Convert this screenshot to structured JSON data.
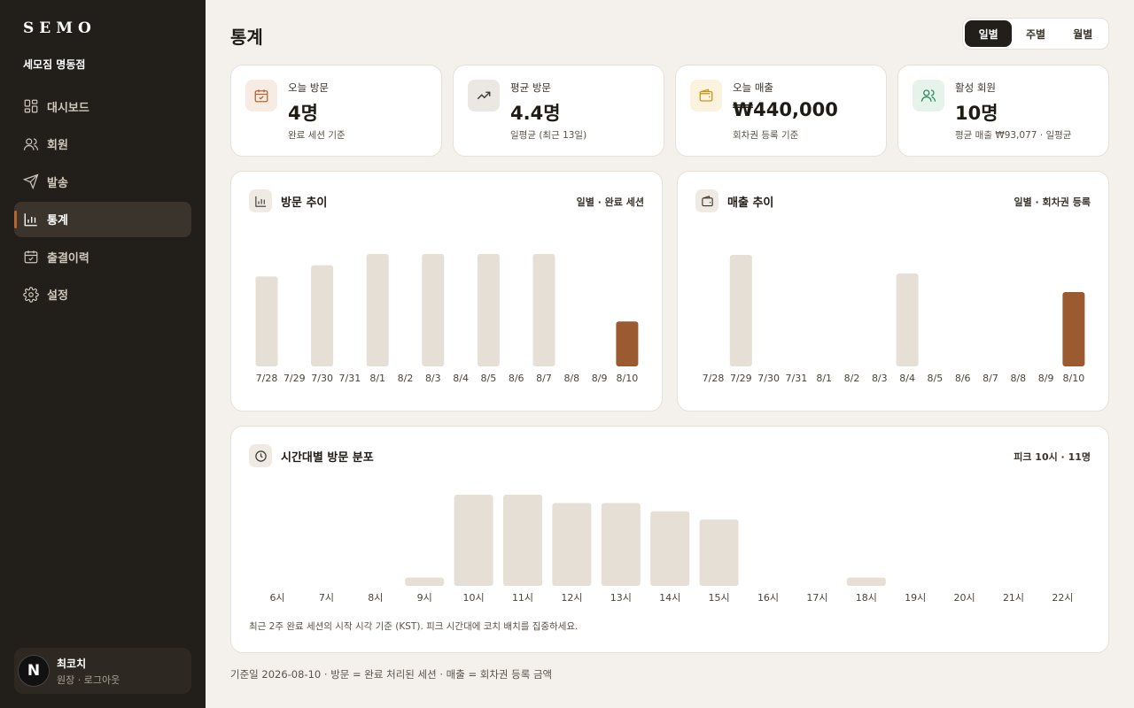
{
  "sidebar": {
    "logo": "SEMO",
    "store": "세모짐 명동점",
    "items": [
      {
        "label": "대시보드",
        "icon": "dashboard-icon"
      },
      {
        "label": "회원",
        "icon": "members-icon"
      },
      {
        "label": "발송",
        "icon": "send-icon"
      },
      {
        "label": "통계",
        "icon": "stats-icon",
        "active": true
      },
      {
        "label": "출결이력",
        "icon": "calendar-check-icon"
      },
      {
        "label": "설정",
        "icon": "gear-icon"
      }
    ],
    "user": {
      "avatar": "N",
      "name": "최코치",
      "sub": "원장 · 로그아웃"
    }
  },
  "header": {
    "title": "통계",
    "period_tabs": [
      "일별",
      "주별",
      "월별"
    ],
    "active_tab": "일별"
  },
  "stats": [
    {
      "label": "오늘 방문",
      "value": "4명",
      "note": "완료 세션 기준",
      "icon": "calendar-check-icon",
      "color": "#b8642e",
      "bg": "#f7ece4"
    },
    {
      "label": "평균 방문",
      "value": "4.4명",
      "note": "일평균 (최근 13일)",
      "icon": "trend-up-icon",
      "color": "#3a342d",
      "bg": "#ebe8e3"
    },
    {
      "label": "오늘 매출",
      "value": "₩440,000",
      "note": "회차권 등록 기준",
      "icon": "wallet-icon",
      "color": "#c99417",
      "bg": "#fbf3de"
    },
    {
      "label": "활성 회원",
      "value": "10명",
      "note": "평균 매출 ₩93,077 · 일평균",
      "icon": "users-icon",
      "color": "#2f8a5a",
      "bg": "#e5f3ea"
    }
  ],
  "visits": {
    "title": "방문 추이",
    "subtitle": "일별 · 완료 세션",
    "icon": "bar-chart-icon"
  },
  "revenue": {
    "title": "매출 추이",
    "subtitle": "일별 · 회차권 등록",
    "icon": "wallet-icon"
  },
  "hourly": {
    "title": "시간대별 방문 분포",
    "subtitle": "피크 10시 · 11명",
    "icon": "clock-icon",
    "caption": "최근 2주 완료 세션의 시작 시각 기준 (KST). 피크 시간대에 코치 배치를 집중하세요."
  },
  "footer": "기준일 2026-08-10 · 방문 = 완료 처리된 세션 · 매출 = 회차권 등록 금액",
  "colors": {
    "bar": "#e5dfd6",
    "highlight": "#9c5a30",
    "sidebar": "#221e19"
  },
  "chart_data": [
    {
      "type": "bar",
      "title": "방문 추이",
      "categories": [
        "7/28",
        "7/29",
        "7/30",
        "7/31",
        "8/1",
        "8/2",
        "8/3",
        "8/4",
        "8/5",
        "8/6",
        "8/7",
        "8/8",
        "8/9",
        "8/10"
      ],
      "values": [
        8,
        0,
        9,
        0,
        10,
        0,
        10,
        0,
        10,
        0,
        10,
        0,
        0,
        4
      ],
      "highlight_index": 13,
      "ylim": [
        0,
        10
      ]
    },
    {
      "type": "bar",
      "title": "매출 추이",
      "categories": [
        "7/28",
        "7/29",
        "7/30",
        "7/31",
        "8/1",
        "8/2",
        "8/3",
        "8/4",
        "8/5",
        "8/6",
        "8/7",
        "8/8",
        "8/9",
        "8/10"
      ],
      "values": [
        0,
        660000,
        0,
        0,
        0,
        0,
        0,
        550000,
        0,
        0,
        0,
        0,
        0,
        440000
      ],
      "highlight_index": 13,
      "ylim": [
        0,
        660000
      ]
    },
    {
      "type": "bar",
      "title": "시간대별 방문 분포",
      "categories": [
        "6시",
        "7시",
        "8시",
        "9시",
        "10시",
        "11시",
        "12시",
        "13시",
        "14시",
        "15시",
        "16시",
        "17시",
        "18시",
        "19시",
        "20시",
        "21시",
        "22시"
      ],
      "values": [
        0,
        0,
        0,
        1,
        11,
        11,
        10,
        10,
        9,
        8,
        0,
        0,
        1,
        0,
        0,
        0,
        0
      ],
      "ylim": [
        0,
        11
      ]
    }
  ]
}
